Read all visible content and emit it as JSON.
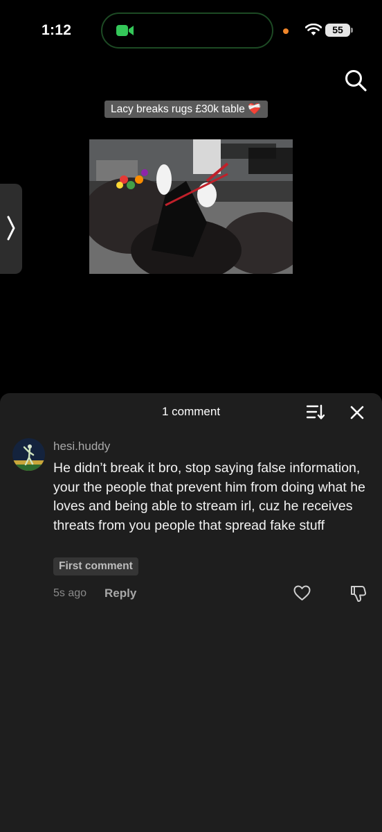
{
  "status_bar": {
    "time": "1:12",
    "battery": "55"
  },
  "video": {
    "caption": "Lacy breaks rugs £30k table",
    "caption_emoji": "❤️‍🩹"
  },
  "comments_sheet": {
    "title": "1 comment",
    "comments": [
      {
        "username": "hesi.huddy",
        "text": "He didn’t break it bro, stop saying false information, your the people that prevent him from doing what he loves and being able to stream irl, cuz he receives threats from you people that spread fake stuff",
        "badge": "First comment",
        "timestamp": "5s ago",
        "reply_label": "Reply"
      }
    ]
  },
  "colors": {
    "sheet_bg": "#1e1e1e",
    "pill_bg": "#5a5a5a",
    "facetime_green": "#34c759"
  },
  "icons": [
    "facetime-icon",
    "wifi-icon",
    "search-icon",
    "chevron-right-icon",
    "sort-icon",
    "close-icon",
    "heart-icon",
    "dislike-icon"
  ]
}
